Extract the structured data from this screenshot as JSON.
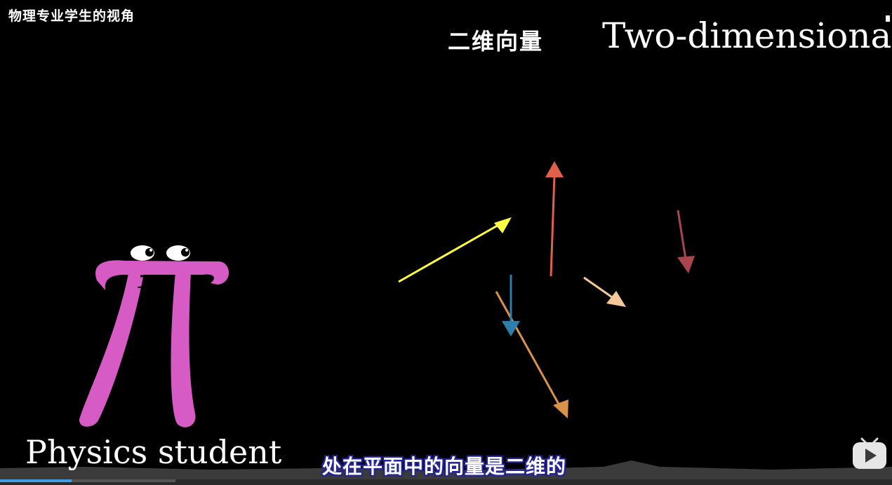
{
  "overlay": {
    "corner_title": "物理专业学生的视角"
  },
  "scene": {
    "heading_cn": "二维向量",
    "heading_en": "Two-dimensional",
    "caption_en": "Physics student",
    "subtitle": "处在平面中的向量是二维的"
  },
  "player": {
    "progress": 0.08,
    "play_icon": "bilibili-tv-play-icon"
  },
  "character": {
    "icon": "pi-creature-icon",
    "color": "#d65bc4"
  },
  "vectors": [
    {
      "name": "yellow",
      "color": "#ffff44"
    },
    {
      "name": "red",
      "color": "#e0604c"
    },
    {
      "name": "maroon",
      "color": "#a8454f"
    },
    {
      "name": "peach",
      "color": "#f5c89a"
    },
    {
      "name": "blue",
      "color": "#2f7daa"
    },
    {
      "name": "orange",
      "color": "#d8924a"
    }
  ]
}
